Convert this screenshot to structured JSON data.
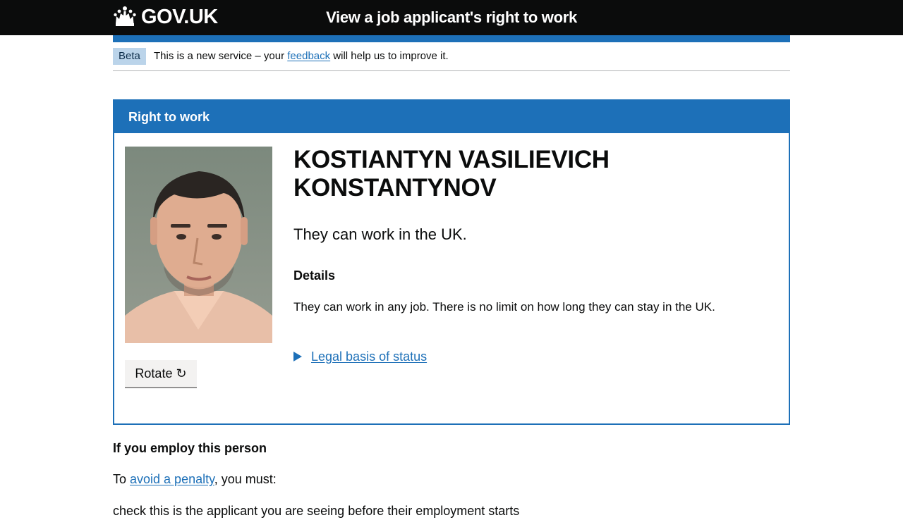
{
  "header": {
    "logo_text": "GOV.UK",
    "logo_icon": "crown-icon",
    "service_name": "View a job applicant's right to work"
  },
  "phase_banner": {
    "tag": "Beta",
    "text_before": "This is a new service – your ",
    "link_text": "feedback",
    "text_after": " will help us to improve it."
  },
  "panel": {
    "title": "Right to work",
    "rotate_label": "Rotate",
    "rotate_icon": "↻",
    "name_line1": "KOSTIANTYN VASILIEVICH",
    "name_line2": "KONSTANTYNOV",
    "status": "They can work in the UK.",
    "details_heading": "Details",
    "details_text": "They can work in any job. There is no limit on how long they can stay in the UK.",
    "legal_link": "Legal basis of status"
  },
  "employ": {
    "heading": "If you employ this person",
    "text_before": "To ",
    "link_text": "avoid a penalty",
    "text_after": ", you must:",
    "cutoff_line": "check this is the applicant you are seeing before their employment starts"
  },
  "colors": {
    "header_bg": "#0b0c0c",
    "brand_blue": "#1d70b8",
    "tag_bg": "#bbd4ea"
  }
}
